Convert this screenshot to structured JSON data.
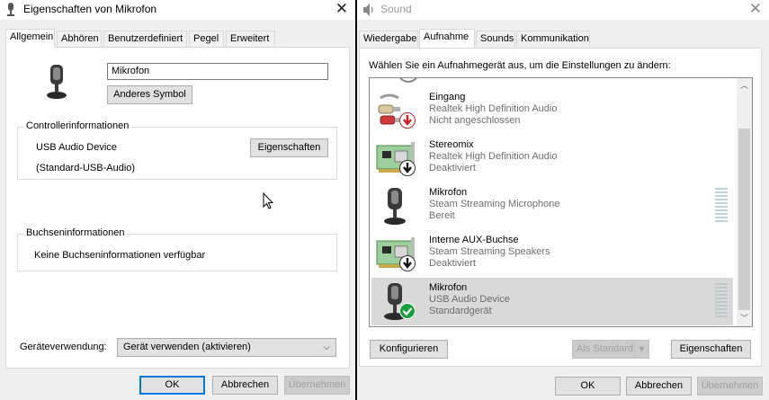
{
  "left_window": {
    "title": "Eigenschaften von Mikrofon",
    "tabs": [
      "Allgemein",
      "Abhören",
      "Benutzerdefiniert",
      "Pegel",
      "Erweitert"
    ],
    "device_name_value": "Mikrofon",
    "change_icon_label": "Anderes Symbol",
    "controller": {
      "heading": "Controllerinformationen",
      "device": "USB Audio Device",
      "properties_label": "Eigenschaften",
      "driver": "(Standard-USB-Audio)"
    },
    "jack": {
      "heading": "Buchseninformationen",
      "text": "Keine Buchseninformationen verfügbar"
    },
    "usage": {
      "label": "Geräteverwendung:",
      "selected": "Gerät verwenden (aktivieren)"
    },
    "buttons": {
      "ok": "OK",
      "cancel": "Abbrechen",
      "apply": "Übernehmen"
    }
  },
  "right_window": {
    "title": "Sound",
    "tabs": [
      "Wiedergabe",
      "Aufnahme",
      "Sounds",
      "Kommunikation"
    ],
    "instruction": "Wählen Sie ein Aufnahmegerät aus, um die Einstellungen zu ändern:",
    "devices": [
      {
        "name": "Eingang",
        "desc": "Realtek High Definition Audio",
        "status": "Nicht angeschlossen",
        "icon": "audio-jack-icon",
        "badge": "disconnected-badge-icon",
        "meter": false,
        "selected": false
      },
      {
        "name": "Stereomix",
        "desc": "Realtek High Definition Audio",
        "status": "Deaktiviert",
        "icon": "sound-card-icon",
        "badge": "disabled-badge-icon",
        "meter": false,
        "selected": false
      },
      {
        "name": "Mikrofon",
        "desc": "Steam Streaming Microphone",
        "status": "Bereit",
        "icon": "microphone-icon",
        "badge": "",
        "meter": true,
        "selected": false
      },
      {
        "name": "Interne AUX-Buchse",
        "desc": "Steam Streaming Speakers",
        "status": "Deaktiviert",
        "icon": "sound-card-icon",
        "badge": "disabled-badge-icon",
        "meter": false,
        "selected": false
      },
      {
        "name": "Mikrofon",
        "desc": "USB Audio Device",
        "status": "Standardgerät",
        "icon": "microphone-icon",
        "badge": "default-check-badge-icon",
        "meter": true,
        "selected": true
      }
    ],
    "configure_label": "Konfigurieren",
    "set_default_label": "Als Standard",
    "properties_label": "Eigenschaften",
    "buttons": {
      "ok": "OK",
      "cancel": "Abbrechen",
      "apply": "Übernehmen"
    }
  },
  "colors": {
    "accent": "#0078d7",
    "window_bg": "#f0f0f0",
    "selection": "#d9d9d9",
    "check_green": "#1a9e3f",
    "disconnect_red": "#d11d1d"
  }
}
